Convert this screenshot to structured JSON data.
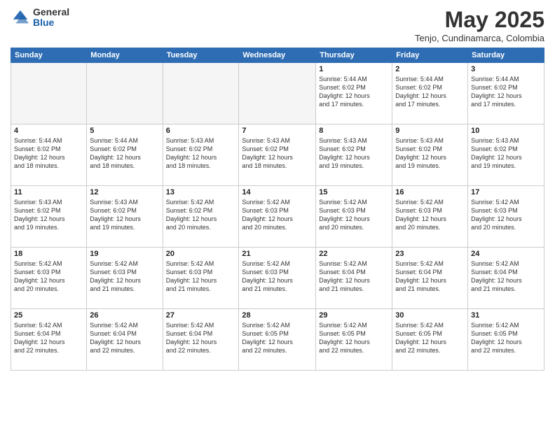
{
  "header": {
    "logo": {
      "general": "General",
      "blue": "Blue"
    },
    "title": "May 2025",
    "subtitle": "Tenjo, Cundinamarca, Colombia"
  },
  "weekdays": [
    "Sunday",
    "Monday",
    "Tuesday",
    "Wednesday",
    "Thursday",
    "Friday",
    "Saturday"
  ],
  "weeks": [
    [
      {
        "day": "",
        "info": ""
      },
      {
        "day": "",
        "info": ""
      },
      {
        "day": "",
        "info": ""
      },
      {
        "day": "",
        "info": ""
      },
      {
        "day": "1",
        "info": "Sunrise: 5:44 AM\nSunset: 6:02 PM\nDaylight: 12 hours\nand 17 minutes."
      },
      {
        "day": "2",
        "info": "Sunrise: 5:44 AM\nSunset: 6:02 PM\nDaylight: 12 hours\nand 17 minutes."
      },
      {
        "day": "3",
        "info": "Sunrise: 5:44 AM\nSunset: 6:02 PM\nDaylight: 12 hours\nand 17 minutes."
      }
    ],
    [
      {
        "day": "4",
        "info": "Sunrise: 5:44 AM\nSunset: 6:02 PM\nDaylight: 12 hours\nand 18 minutes."
      },
      {
        "day": "5",
        "info": "Sunrise: 5:44 AM\nSunset: 6:02 PM\nDaylight: 12 hours\nand 18 minutes."
      },
      {
        "day": "6",
        "info": "Sunrise: 5:43 AM\nSunset: 6:02 PM\nDaylight: 12 hours\nand 18 minutes."
      },
      {
        "day": "7",
        "info": "Sunrise: 5:43 AM\nSunset: 6:02 PM\nDaylight: 12 hours\nand 18 minutes."
      },
      {
        "day": "8",
        "info": "Sunrise: 5:43 AM\nSunset: 6:02 PM\nDaylight: 12 hours\nand 19 minutes."
      },
      {
        "day": "9",
        "info": "Sunrise: 5:43 AM\nSunset: 6:02 PM\nDaylight: 12 hours\nand 19 minutes."
      },
      {
        "day": "10",
        "info": "Sunrise: 5:43 AM\nSunset: 6:02 PM\nDaylight: 12 hours\nand 19 minutes."
      }
    ],
    [
      {
        "day": "11",
        "info": "Sunrise: 5:43 AM\nSunset: 6:02 PM\nDaylight: 12 hours\nand 19 minutes."
      },
      {
        "day": "12",
        "info": "Sunrise: 5:43 AM\nSunset: 6:02 PM\nDaylight: 12 hours\nand 19 minutes."
      },
      {
        "day": "13",
        "info": "Sunrise: 5:42 AM\nSunset: 6:02 PM\nDaylight: 12 hours\nand 20 minutes."
      },
      {
        "day": "14",
        "info": "Sunrise: 5:42 AM\nSunset: 6:03 PM\nDaylight: 12 hours\nand 20 minutes."
      },
      {
        "day": "15",
        "info": "Sunrise: 5:42 AM\nSunset: 6:03 PM\nDaylight: 12 hours\nand 20 minutes."
      },
      {
        "day": "16",
        "info": "Sunrise: 5:42 AM\nSunset: 6:03 PM\nDaylight: 12 hours\nand 20 minutes."
      },
      {
        "day": "17",
        "info": "Sunrise: 5:42 AM\nSunset: 6:03 PM\nDaylight: 12 hours\nand 20 minutes."
      }
    ],
    [
      {
        "day": "18",
        "info": "Sunrise: 5:42 AM\nSunset: 6:03 PM\nDaylight: 12 hours\nand 20 minutes."
      },
      {
        "day": "19",
        "info": "Sunrise: 5:42 AM\nSunset: 6:03 PM\nDaylight: 12 hours\nand 21 minutes."
      },
      {
        "day": "20",
        "info": "Sunrise: 5:42 AM\nSunset: 6:03 PM\nDaylight: 12 hours\nand 21 minutes."
      },
      {
        "day": "21",
        "info": "Sunrise: 5:42 AM\nSunset: 6:03 PM\nDaylight: 12 hours\nand 21 minutes."
      },
      {
        "day": "22",
        "info": "Sunrise: 5:42 AM\nSunset: 6:04 PM\nDaylight: 12 hours\nand 21 minutes."
      },
      {
        "day": "23",
        "info": "Sunrise: 5:42 AM\nSunset: 6:04 PM\nDaylight: 12 hours\nand 21 minutes."
      },
      {
        "day": "24",
        "info": "Sunrise: 5:42 AM\nSunset: 6:04 PM\nDaylight: 12 hours\nand 21 minutes."
      }
    ],
    [
      {
        "day": "25",
        "info": "Sunrise: 5:42 AM\nSunset: 6:04 PM\nDaylight: 12 hours\nand 22 minutes."
      },
      {
        "day": "26",
        "info": "Sunrise: 5:42 AM\nSunset: 6:04 PM\nDaylight: 12 hours\nand 22 minutes."
      },
      {
        "day": "27",
        "info": "Sunrise: 5:42 AM\nSunset: 6:04 PM\nDaylight: 12 hours\nand 22 minutes."
      },
      {
        "day": "28",
        "info": "Sunrise: 5:42 AM\nSunset: 6:05 PM\nDaylight: 12 hours\nand 22 minutes."
      },
      {
        "day": "29",
        "info": "Sunrise: 5:42 AM\nSunset: 6:05 PM\nDaylight: 12 hours\nand 22 minutes."
      },
      {
        "day": "30",
        "info": "Sunrise: 5:42 AM\nSunset: 6:05 PM\nDaylight: 12 hours\nand 22 minutes."
      },
      {
        "day": "31",
        "info": "Sunrise: 5:42 AM\nSunset: 6:05 PM\nDaylight: 12 hours\nand 22 minutes."
      }
    ]
  ]
}
